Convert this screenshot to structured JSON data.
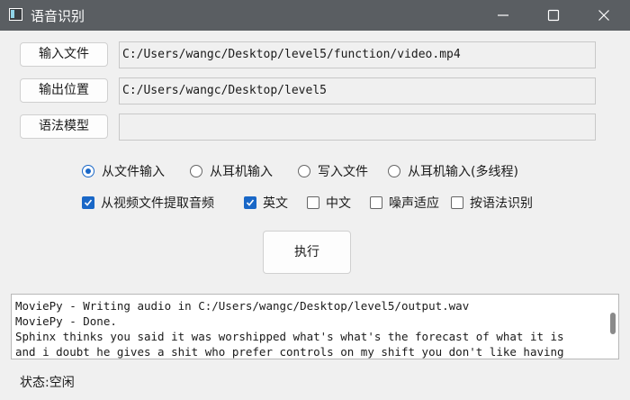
{
  "window": {
    "title": "语音识别",
    "icons": [
      "app-icon",
      "minimize-icon",
      "maximize-icon",
      "close-icon"
    ]
  },
  "inputs": {
    "input_file_button": "输入文件",
    "input_file_path": "C:/Users/wangc/Desktop/level5/function/video.mp4",
    "output_button": "输出位置",
    "output_path": "C:/Users/wangc/Desktop/level5",
    "grammar_button": "语法模型",
    "grammar_path": ""
  },
  "modes": [
    {
      "label": "从文件输入",
      "selected": true
    },
    {
      "label": "从耳机输入",
      "selected": false
    },
    {
      "label": "写入文件",
      "selected": false
    },
    {
      "label": "从耳机输入(多线程)",
      "selected": false
    }
  ],
  "options": [
    {
      "label": "从视频文件提取音频",
      "checked": true
    },
    {
      "label": "英文",
      "checked": true
    },
    {
      "label": "中文",
      "checked": false
    },
    {
      "label": "噪声适应",
      "checked": false
    },
    {
      "label": "按语法识别",
      "checked": false
    }
  ],
  "execute_button": "执行",
  "log": {
    "lines": [
      "MoviePy - Writing audio in C:/Users/wangc/Desktop/level5/output.wav",
      "MoviePy - Done.",
      "Sphinx thinks you said it was worshipped what's what's the forecast of what it is",
      "and i doubt he gives a shit who prefer controls on my shift you don't like having"
    ]
  },
  "status": "状态:空闲",
  "colors": {
    "accent": "#1967c7",
    "titlebar": "#5a5e62",
    "background": "#f0f0f0"
  }
}
